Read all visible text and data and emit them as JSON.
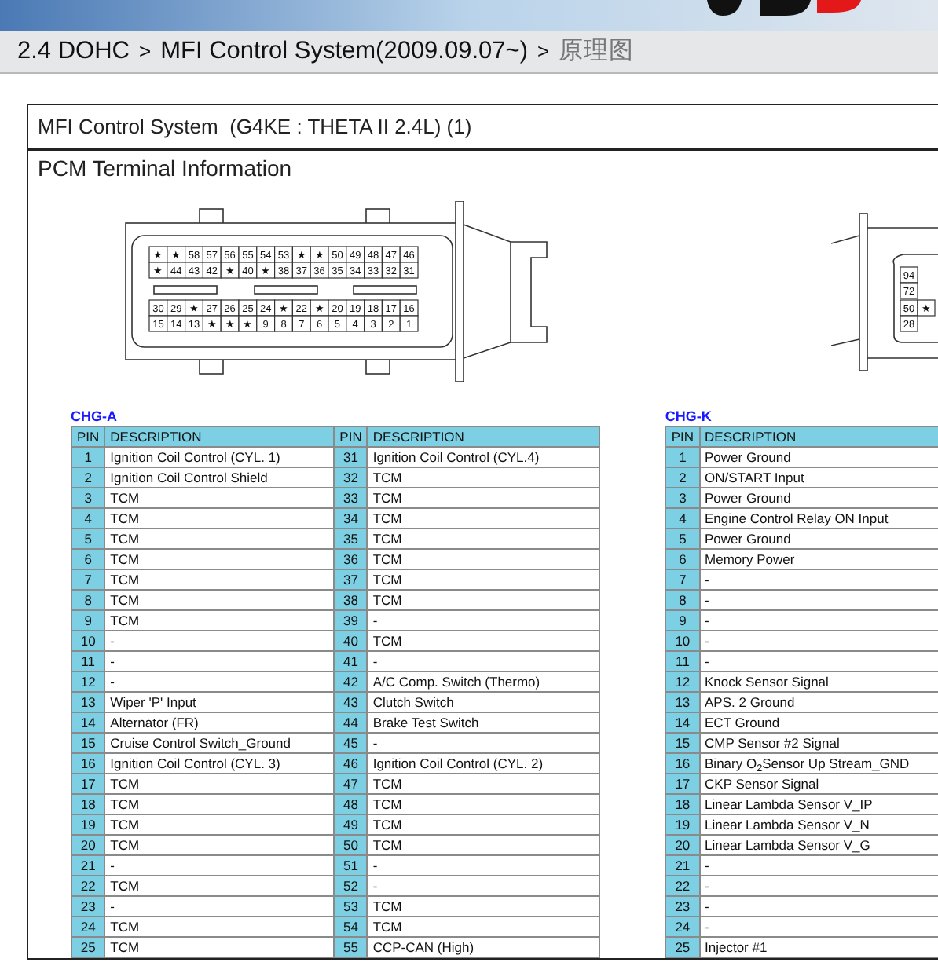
{
  "breadcrumb": [
    {
      "kind": "link",
      "text": "2.4 DOHC"
    },
    {
      "kind": "separator",
      "text": ">"
    },
    {
      "kind": "link",
      "text": "MFI Control System(2009.09.07~)"
    },
    {
      "kind": "separator",
      "text": ">"
    },
    {
      "kind": "current",
      "text": "原理图"
    }
  ],
  "document": {
    "title": "MFI Control System  (G4KE : THETA II 2.4L) (1)",
    "section": "PCM Terminal Information",
    "connectors": [
      {
        "rows": [
          [
            "★",
            "★",
            "58",
            "57",
            "56",
            "55",
            "54",
            "53",
            "★",
            "★",
            "50",
            "49",
            "48",
            "47",
            "46"
          ],
          [
            "★",
            "44",
            "43",
            "42",
            "★",
            "40",
            "★",
            "38",
            "37",
            "36",
            "35",
            "34",
            "33",
            "32",
            "31"
          ],
          [
            "30",
            "29",
            "★",
            "27",
            "26",
            "25",
            "24",
            "★",
            "22",
            "★",
            "20",
            "19",
            "18",
            "17",
            "16"
          ],
          [
            "15",
            "14",
            "13",
            "★",
            "★",
            "★",
            "9",
            "8",
            "7",
            "6",
            "5",
            "4",
            "3",
            "2",
            "1"
          ]
        ]
      },
      {
        "rows": [
          [
            "94"
          ],
          [
            "72"
          ],
          [
            "50",
            "★"
          ],
          [
            "28"
          ]
        ]
      }
    ],
    "tables": [
      {
        "name": "CHG-A",
        "columns": [
          "PIN",
          "DESCRIPTION",
          "PIN",
          "DESCRIPTION"
        ],
        "rows": [
          [
            "1",
            "Ignition Coil Control (CYL. 1)",
            "31",
            "Ignition Coil Control (CYL.4)"
          ],
          [
            "2",
            "Ignition Coil Control Shield",
            "32",
            "TCM"
          ],
          [
            "3",
            "TCM",
            "33",
            "TCM"
          ],
          [
            "4",
            "TCM",
            "34",
            "TCM"
          ],
          [
            "5",
            "TCM",
            "35",
            "TCM"
          ],
          [
            "6",
            "TCM",
            "36",
            "TCM"
          ],
          [
            "7",
            "TCM",
            "37",
            "TCM"
          ],
          [
            "8",
            "TCM",
            "38",
            "TCM"
          ],
          [
            "9",
            "TCM",
            "39",
            "-"
          ],
          [
            "10",
            "-",
            "40",
            "TCM"
          ],
          [
            "11",
            "-",
            "41",
            "-"
          ],
          [
            "12",
            "-",
            "42",
            "A/C Comp. Switch (Thermo)"
          ],
          [
            "13",
            "Wiper 'P' Input",
            "43",
            "Clutch Switch"
          ],
          [
            "14",
            "Alternator (FR)",
            "44",
            "Brake Test Switch"
          ],
          [
            "15",
            "Cruise Control Switch_Ground",
            "45",
            "-"
          ],
          [
            "16",
            "Ignition Coil Control (CYL. 3)",
            "46",
            "Ignition Coil Control (CYL. 2)"
          ],
          [
            "17",
            "TCM",
            "47",
            "TCM"
          ],
          [
            "18",
            "TCM",
            "48",
            "TCM"
          ],
          [
            "19",
            "TCM",
            "49",
            "TCM"
          ],
          [
            "20",
            "TCM",
            "50",
            "TCM"
          ],
          [
            "21",
            "-",
            "51",
            "-"
          ],
          [
            "22",
            "TCM",
            "52",
            "-"
          ],
          [
            "23",
            "-",
            "53",
            "TCM"
          ],
          [
            "24",
            "TCM",
            "54",
            "TCM"
          ],
          [
            "25",
            "TCM",
            "55",
            "CCP-CAN (High)"
          ]
        ]
      },
      {
        "name": "CHG-K",
        "columns": [
          "PIN",
          "DESCRIPTION"
        ],
        "rows": [
          [
            "1",
            "Power Ground"
          ],
          [
            "2",
            "ON/START Input"
          ],
          [
            "3",
            "Power Ground"
          ],
          [
            "4",
            "Engine Control Relay ON Input"
          ],
          [
            "5",
            "Power Ground"
          ],
          [
            "6",
            "Memory Power"
          ],
          [
            "7",
            "-"
          ],
          [
            "8",
            "-"
          ],
          [
            "9",
            "-"
          ],
          [
            "10",
            "-"
          ],
          [
            "11",
            "-"
          ],
          [
            "12",
            "Knock Sensor Signal"
          ],
          [
            "13",
            "APS. 2 Ground"
          ],
          [
            "14",
            "ECT Ground"
          ],
          [
            "15",
            "CMP Sensor #2 Signal"
          ],
          [
            "16",
            "Binary O$_{2}$Sensor Up Stream_GND"
          ],
          [
            "17",
            "CKP Sensor Signal"
          ],
          [
            "18",
            "Linear Lambda Sensor V_IP"
          ],
          [
            "19",
            "Linear Lambda Sensor V_N"
          ],
          [
            "20",
            "Linear Lambda Sensor V_G"
          ],
          [
            "21",
            "-"
          ],
          [
            "22",
            "-"
          ],
          [
            "23",
            "-"
          ],
          [
            "24",
            "-"
          ],
          [
            "25",
            "Injector #1"
          ]
        ]
      }
    ]
  }
}
